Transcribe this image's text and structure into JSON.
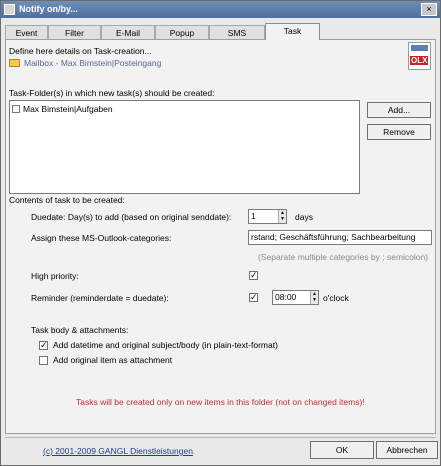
{
  "window": {
    "title": "Notify on/by...",
    "close_glyph": "×"
  },
  "tabs": [
    "Event",
    "Filter",
    "E-Mail",
    "Popup",
    "SMS",
    "Task"
  ],
  "active_tab": "Task",
  "header": {
    "intro": "Define here details on Task-creation...",
    "mailbox": "Mailbox - Max Bimstein|Posteingang",
    "logo_text": "OLX"
  },
  "folders": {
    "label": "Task-Folder(s) in which new task(s) should be created:",
    "items": [
      "Max Bimstein|Aufgaben"
    ],
    "add_label": "Add...",
    "remove_label": "Remove"
  },
  "contents": {
    "label": "Contents of task to be created:",
    "duedate_label": "Duedate: Day(s) to add (based on original senddate):",
    "duedate_value": "1",
    "days_label": "days",
    "categories_label": "Assign these MS-Outlook-categories:",
    "categories_value": "rstand; Geschäftsführung; Sachbearbeitung",
    "categories_hint": "(Separate multiple categories  by ; semicolon)",
    "priority_label": "High priority:",
    "priority_checked": true,
    "reminder_label": "Reminder  (reminderdate = duedate):",
    "reminder_checked": true,
    "reminder_time": "08:00",
    "oclock_label": "o'clock"
  },
  "body_section": {
    "label": "Task body & attachments:",
    "opt1_label": "Add datetime and original subject/body (in plain-text-format)",
    "opt1_checked": true,
    "opt2_label": "Add original item as attachment",
    "opt2_checked": false
  },
  "warning": "Tasks will be created only on new items in this folder (not on changed items)!",
  "footer": {
    "copyright": "(c) 2001-2009 GANGL Dienstleistungen",
    "ok_label": "OK",
    "cancel_label": "Abbrechen"
  }
}
